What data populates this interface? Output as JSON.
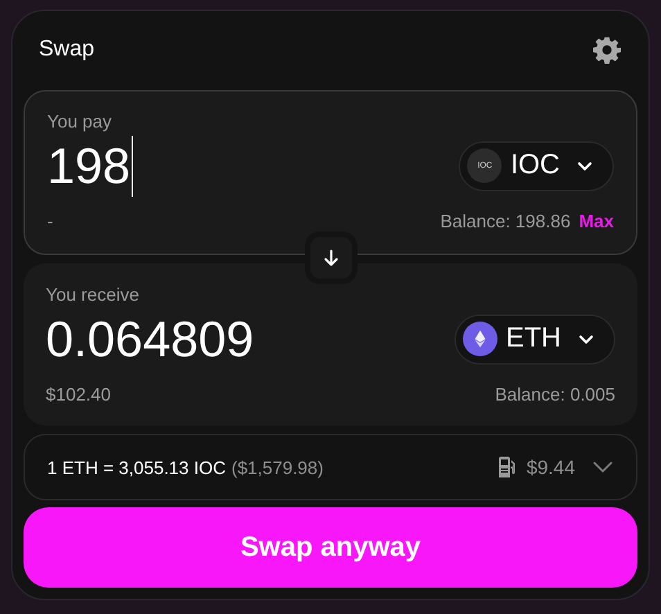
{
  "title": "Swap",
  "pay": {
    "label": "You pay",
    "value": "198",
    "focused": true,
    "token": {
      "symbol": "IOC",
      "kind": "ioc",
      "icon_text": "IOC"
    },
    "usd": "-",
    "balance": "Balance: 198.86",
    "max": "Max"
  },
  "receive": {
    "label": "You receive",
    "value": "0.064809",
    "focused": false,
    "token": {
      "symbol": "ETH",
      "kind": "eth"
    },
    "usd": "$102.40",
    "balance": "Balance: 0.005"
  },
  "rate": {
    "text": "1 ETH = 3,055.13 IOC",
    "usd": "($1,579.98)",
    "gas": "$9.44",
    "expanded": false
  },
  "button": "Swap anyway"
}
